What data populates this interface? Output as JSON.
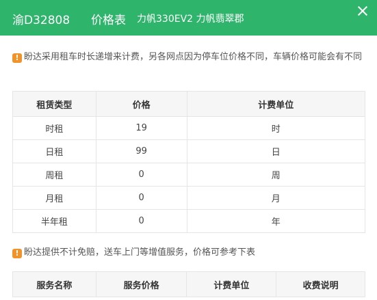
{
  "header": {
    "plate": "渝D32808",
    "title": "价格表",
    "car": "力帆330EV2  力帆翡翠郡"
  },
  "notice1": {
    "icon": "!",
    "text": "盼达采用租车时长递增来计费，另各网点因为停车位价格不同，车辆价格可能会有不同"
  },
  "price_table": {
    "headers": [
      "租赁类型",
      "价格",
      "计费单位"
    ],
    "rows": [
      [
        "时租",
        "19",
        "时"
      ],
      [
        "日租",
        "99",
        "日"
      ],
      [
        "周租",
        "0",
        "周"
      ],
      [
        "月租",
        "0",
        "月"
      ],
      [
        "半年租",
        "0",
        "年"
      ]
    ]
  },
  "notice2": {
    "icon": "!",
    "text": "盼达提供不计免赔，送车上门等增值服务，价格可参考下表"
  },
  "service_table": {
    "headers": [
      "服务名称",
      "服务价格",
      "计费单位",
      "收费说明"
    ]
  },
  "colors": {
    "header_bg": "#2fb46b",
    "warn_icon": "#f0932b"
  }
}
